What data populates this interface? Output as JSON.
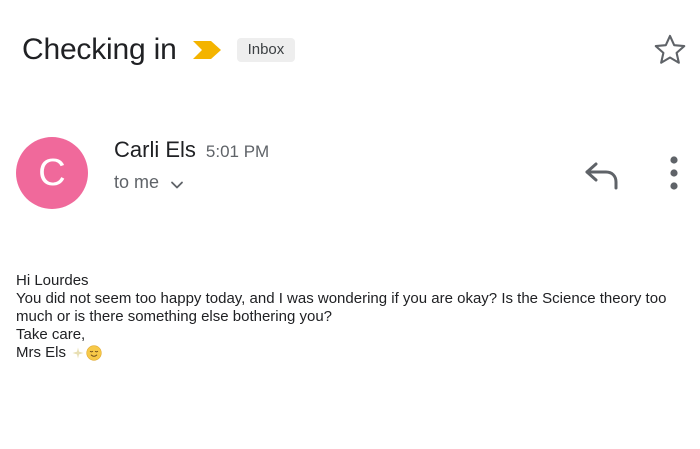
{
  "email": {
    "subject": "Checking in",
    "label": "Inbox",
    "importance_color": "#f4b400"
  },
  "sender": {
    "avatar_letter": "C",
    "avatar_color": "#f0699b",
    "name": "Carli Els",
    "time": "5:01 PM",
    "recipient": "to me"
  },
  "icons": {
    "importance": "importance-marker-icon",
    "star": "star-icon",
    "expand": "chevron-down-icon",
    "reply": "reply-icon",
    "more": "more-vertical-icon",
    "sparkle": "sparkles-emoji",
    "smile": "relieved-face-emoji"
  },
  "body": {
    "greeting": "Hi Lourdes",
    "message": "You did not seem too happy today, and I was wondering if you are okay? Is the Science theory too much or is there something else bothering you?",
    "closing": "Take care,",
    "signature": "Mrs Els"
  }
}
